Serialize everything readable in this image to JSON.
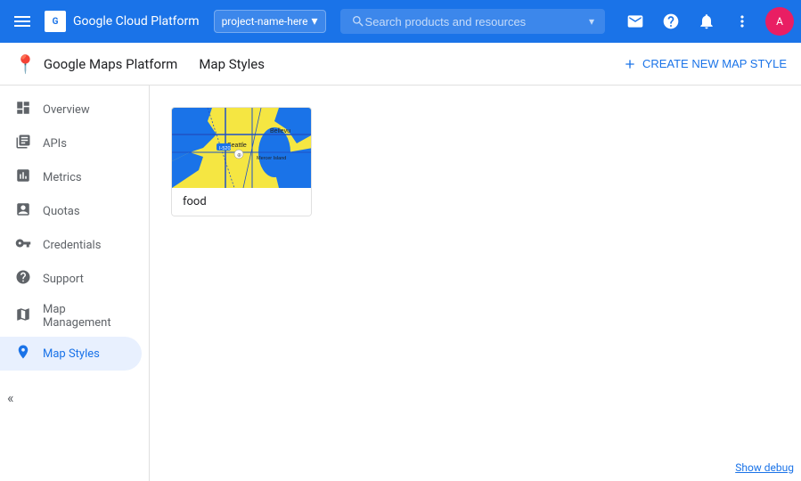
{
  "header": {
    "app_title": "Google Cloud Platform",
    "project_name": "project-name-here",
    "search_placeholder": "Search products and resources",
    "hamburger_label": "Main menu"
  },
  "sub_header": {
    "brand_title": "Google Maps Platform",
    "page_title": "Map Styles",
    "create_button_label": "CREATE NEW MAP STYLE"
  },
  "sidebar": {
    "items": [
      {
        "id": "overview",
        "label": "Overview",
        "icon": "≡"
      },
      {
        "id": "apis",
        "label": "APIs",
        "icon": "⊞"
      },
      {
        "id": "metrics",
        "label": "Metrics",
        "icon": "▦"
      },
      {
        "id": "quotas",
        "label": "Quotas",
        "icon": "□"
      },
      {
        "id": "credentials",
        "label": "Credentials",
        "icon": "⚷"
      },
      {
        "id": "support",
        "label": "Support",
        "icon": "👤"
      },
      {
        "id": "map-management",
        "label": "Map Management",
        "icon": "⊟"
      },
      {
        "id": "map-styles",
        "label": "Map Styles",
        "icon": "◎",
        "active": true
      }
    ],
    "collapse_icon": "«"
  },
  "main": {
    "style_cards": [
      {
        "id": "food",
        "label": "food",
        "preview_colors": {
          "water": "#1a73e8",
          "land": "#f5e642",
          "roads": "#2052c4"
        }
      }
    ]
  },
  "footer": {
    "debug_link": "Show debug"
  }
}
